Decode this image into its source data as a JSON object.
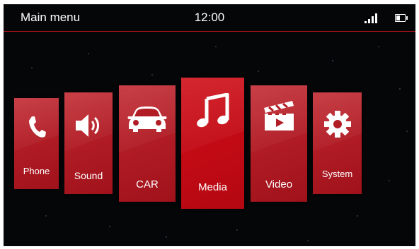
{
  "header": {
    "title": "Main menu",
    "clock": "12:00"
  },
  "tiles": [
    {
      "id": "phone",
      "label": "Phone",
      "icon": "phone-icon"
    },
    {
      "id": "sound",
      "label": "Sound",
      "icon": "speaker-icon"
    },
    {
      "id": "car",
      "label": "CAR",
      "icon": "car-icon"
    },
    {
      "id": "media",
      "label": "Media",
      "icon": "music-note-icon",
      "selected": true
    },
    {
      "id": "video",
      "label": "Video",
      "icon": "clapperboard-icon"
    },
    {
      "id": "system",
      "label": "System",
      "icon": "gear-icon"
    }
  ],
  "colors": {
    "accent": "#c00a14",
    "tile": "#b11c25",
    "background": "#050608",
    "divider": "#b3121a"
  }
}
